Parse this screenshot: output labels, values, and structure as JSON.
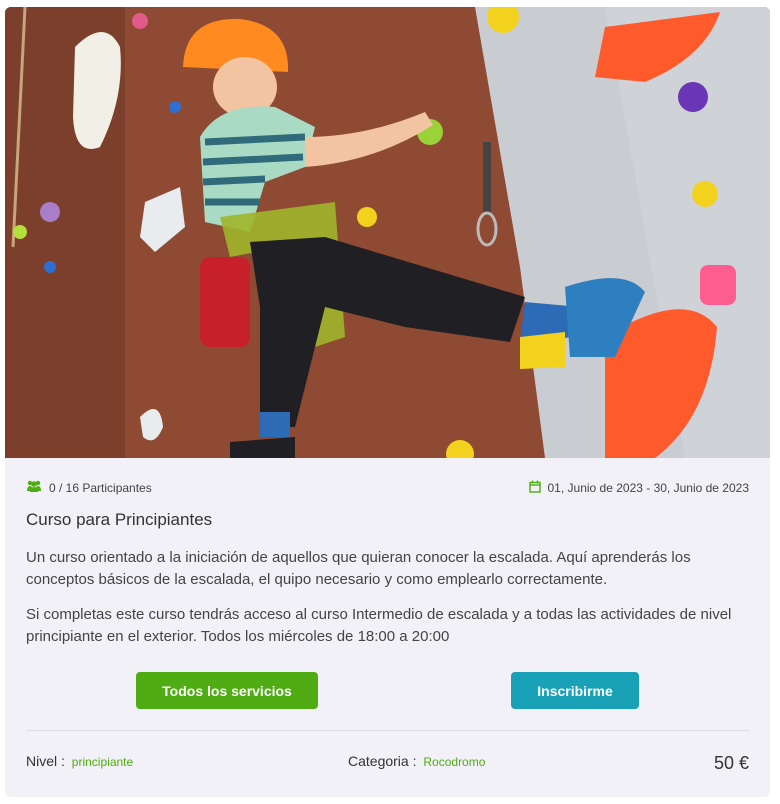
{
  "course": {
    "participants": "0 / 16 Participantes",
    "dates": "01, Junio de 2023 - 30, Junio de 2023",
    "title": "Curso para Principiantes",
    "description": [
      "Un curso orientado a la iniciación de aquellos que quieran conocer la escalada. Aquí aprenderás los conceptos básicos de la escalada, el quipo necesario y como emplearlo correctamente.",
      " Si completas este curso tendrás acceso al curso Intermedio de escalada y a todas las actividades de nivel principiante en el exterior. Todos los miércoles de 18:00 a 20:00"
    ],
    "buttons": {
      "services": "Todos los servicios",
      "enroll": "Inscribirme"
    },
    "footer": {
      "level_label": "Nivel :",
      "level_value": "principiante",
      "category_label": "Categoria :",
      "category_value": "Rocodromo",
      "price": "50 €"
    }
  },
  "colors": {
    "accent_green": "#4fac13",
    "accent_teal": "#19a2b7",
    "card_bg": "#f1f1f7"
  },
  "icons": {
    "participants": "users-icon",
    "dates": "calendar-icon"
  }
}
